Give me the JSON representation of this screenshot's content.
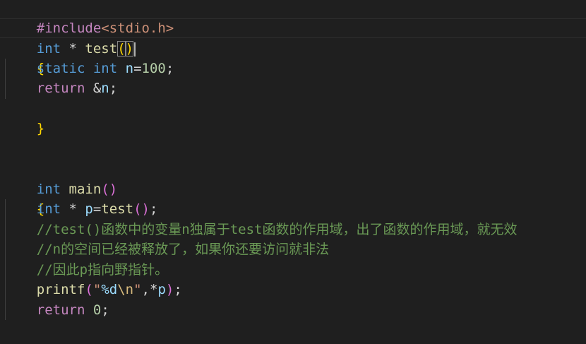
{
  "editor": {
    "language": "c",
    "lines": [
      {
        "id": "l1",
        "pp": "#include",
        "inc": "<stdio.h>"
      },
      {
        "id": "l2",
        "type": "int",
        "star": " * ",
        "fn": "test",
        "open": "(",
        "close": ")"
      },
      {
        "id": "l3",
        "brace": "{"
      },
      {
        "id": "l4",
        "kw1": "static",
        "kw2": "int",
        "var": "n",
        "eq": "=",
        "num": "100",
        "semi": ";"
      },
      {
        "id": "l5",
        "ctrl": "return",
        "amp": " &",
        "var": "n",
        "semi": ";"
      },
      {
        "id": "l6",
        "brace": "}"
      },
      {
        "id": "l7"
      },
      {
        "id": "l8"
      },
      {
        "id": "l9",
        "type": "int",
        "fn": "main",
        "open": "(",
        "close": ")"
      },
      {
        "id": "l10",
        "brace": "{"
      },
      {
        "id": "l11",
        "type": "int",
        "star": " * ",
        "var": "p",
        "eq": "=",
        "fn": "test",
        "open": "(",
        "close": ")",
        "semi": ";"
      },
      {
        "id": "l12",
        "comment": "//test()函数中的变量n独属于test函数的作用域，出了函数的作用域，就无效"
      },
      {
        "id": "l13",
        "comment": "//n的空间已经被释放了，如果你还要访问就非法"
      },
      {
        "id": "l14",
        "comment": "//因此p指向野指针。"
      },
      {
        "id": "l15",
        "fn": "printf",
        "open": "(",
        "q1": "\"",
        "fmt": "%d",
        "esc": "\\n",
        "q2": "\"",
        "comma": ",*",
        "var": "p",
        "close": ")",
        "semi": ";"
      },
      {
        "id": "l16",
        "ctrl": "return",
        "num": "0",
        "semi": ";"
      },
      {
        "id": "l17",
        "brace": "}"
      }
    ]
  },
  "colors": {
    "background": "#1f1f1f",
    "keyword": "#569cd6",
    "control": "#c586c0",
    "function": "#dcdcaa",
    "variable": "#9cdcfe",
    "number": "#b5cea8",
    "string": "#ce9178",
    "comment": "#6a9955",
    "bracket_level_1": "#ffd700",
    "bracket_level_2": "#da70d6"
  }
}
